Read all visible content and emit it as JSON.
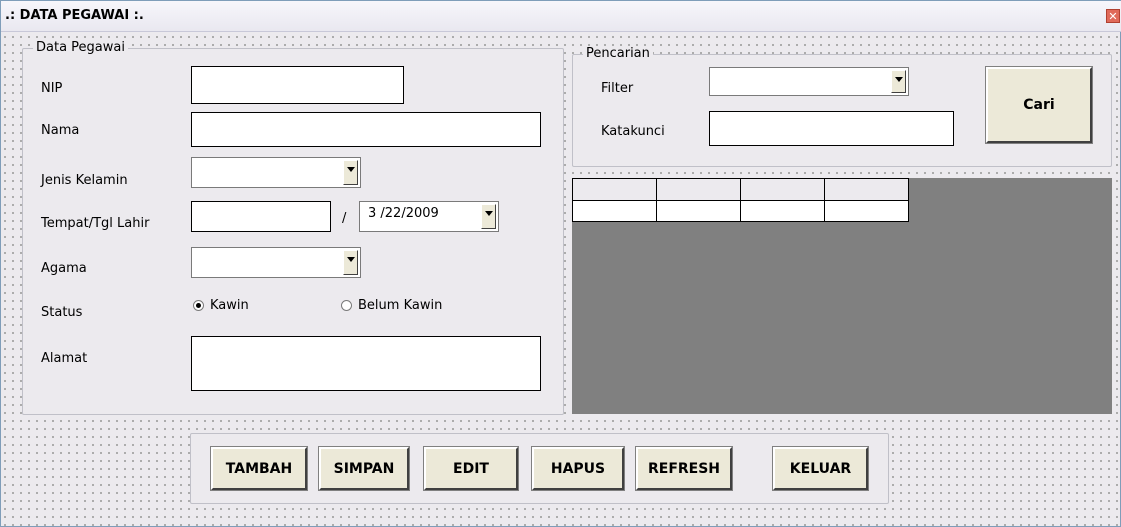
{
  "window": {
    "title": ".: DATA PEGAWAI :.",
    "close_glyph": "✕"
  },
  "data_pegawai": {
    "legend": "Data Pegawai",
    "nip_label": "NIP",
    "nama_label": "Nama",
    "jenis_kelamin_label": "Jenis Kelamin",
    "tempat_tgl_lahir_label": "Tempat/Tgl Lahir",
    "date_separator": "/",
    "tanggal_lahir_value": "3 /22/2009",
    "agama_label": "Agama",
    "status_label": "Status",
    "status_options": [
      "Kawin",
      "Belum Kawin"
    ],
    "status_selected": "Kawin",
    "alamat_label": "Alamat"
  },
  "pencarian": {
    "legend": "Pencarian",
    "filter_label": "Filter",
    "katakunci_label": "Katakunci",
    "cari_button": "Cari"
  },
  "buttons": {
    "tambah": "TAMBAH",
    "simpan": "SIMPAN",
    "edit": "EDIT",
    "hapus": "HAPUS",
    "refresh": "REFRESH",
    "keluar": "KELUAR"
  },
  "icons": {
    "close": "close-icon",
    "dropdown": "chevron-down-icon"
  },
  "colors": {
    "grid_background": "#808080",
    "form_background": "#eceaee"
  }
}
